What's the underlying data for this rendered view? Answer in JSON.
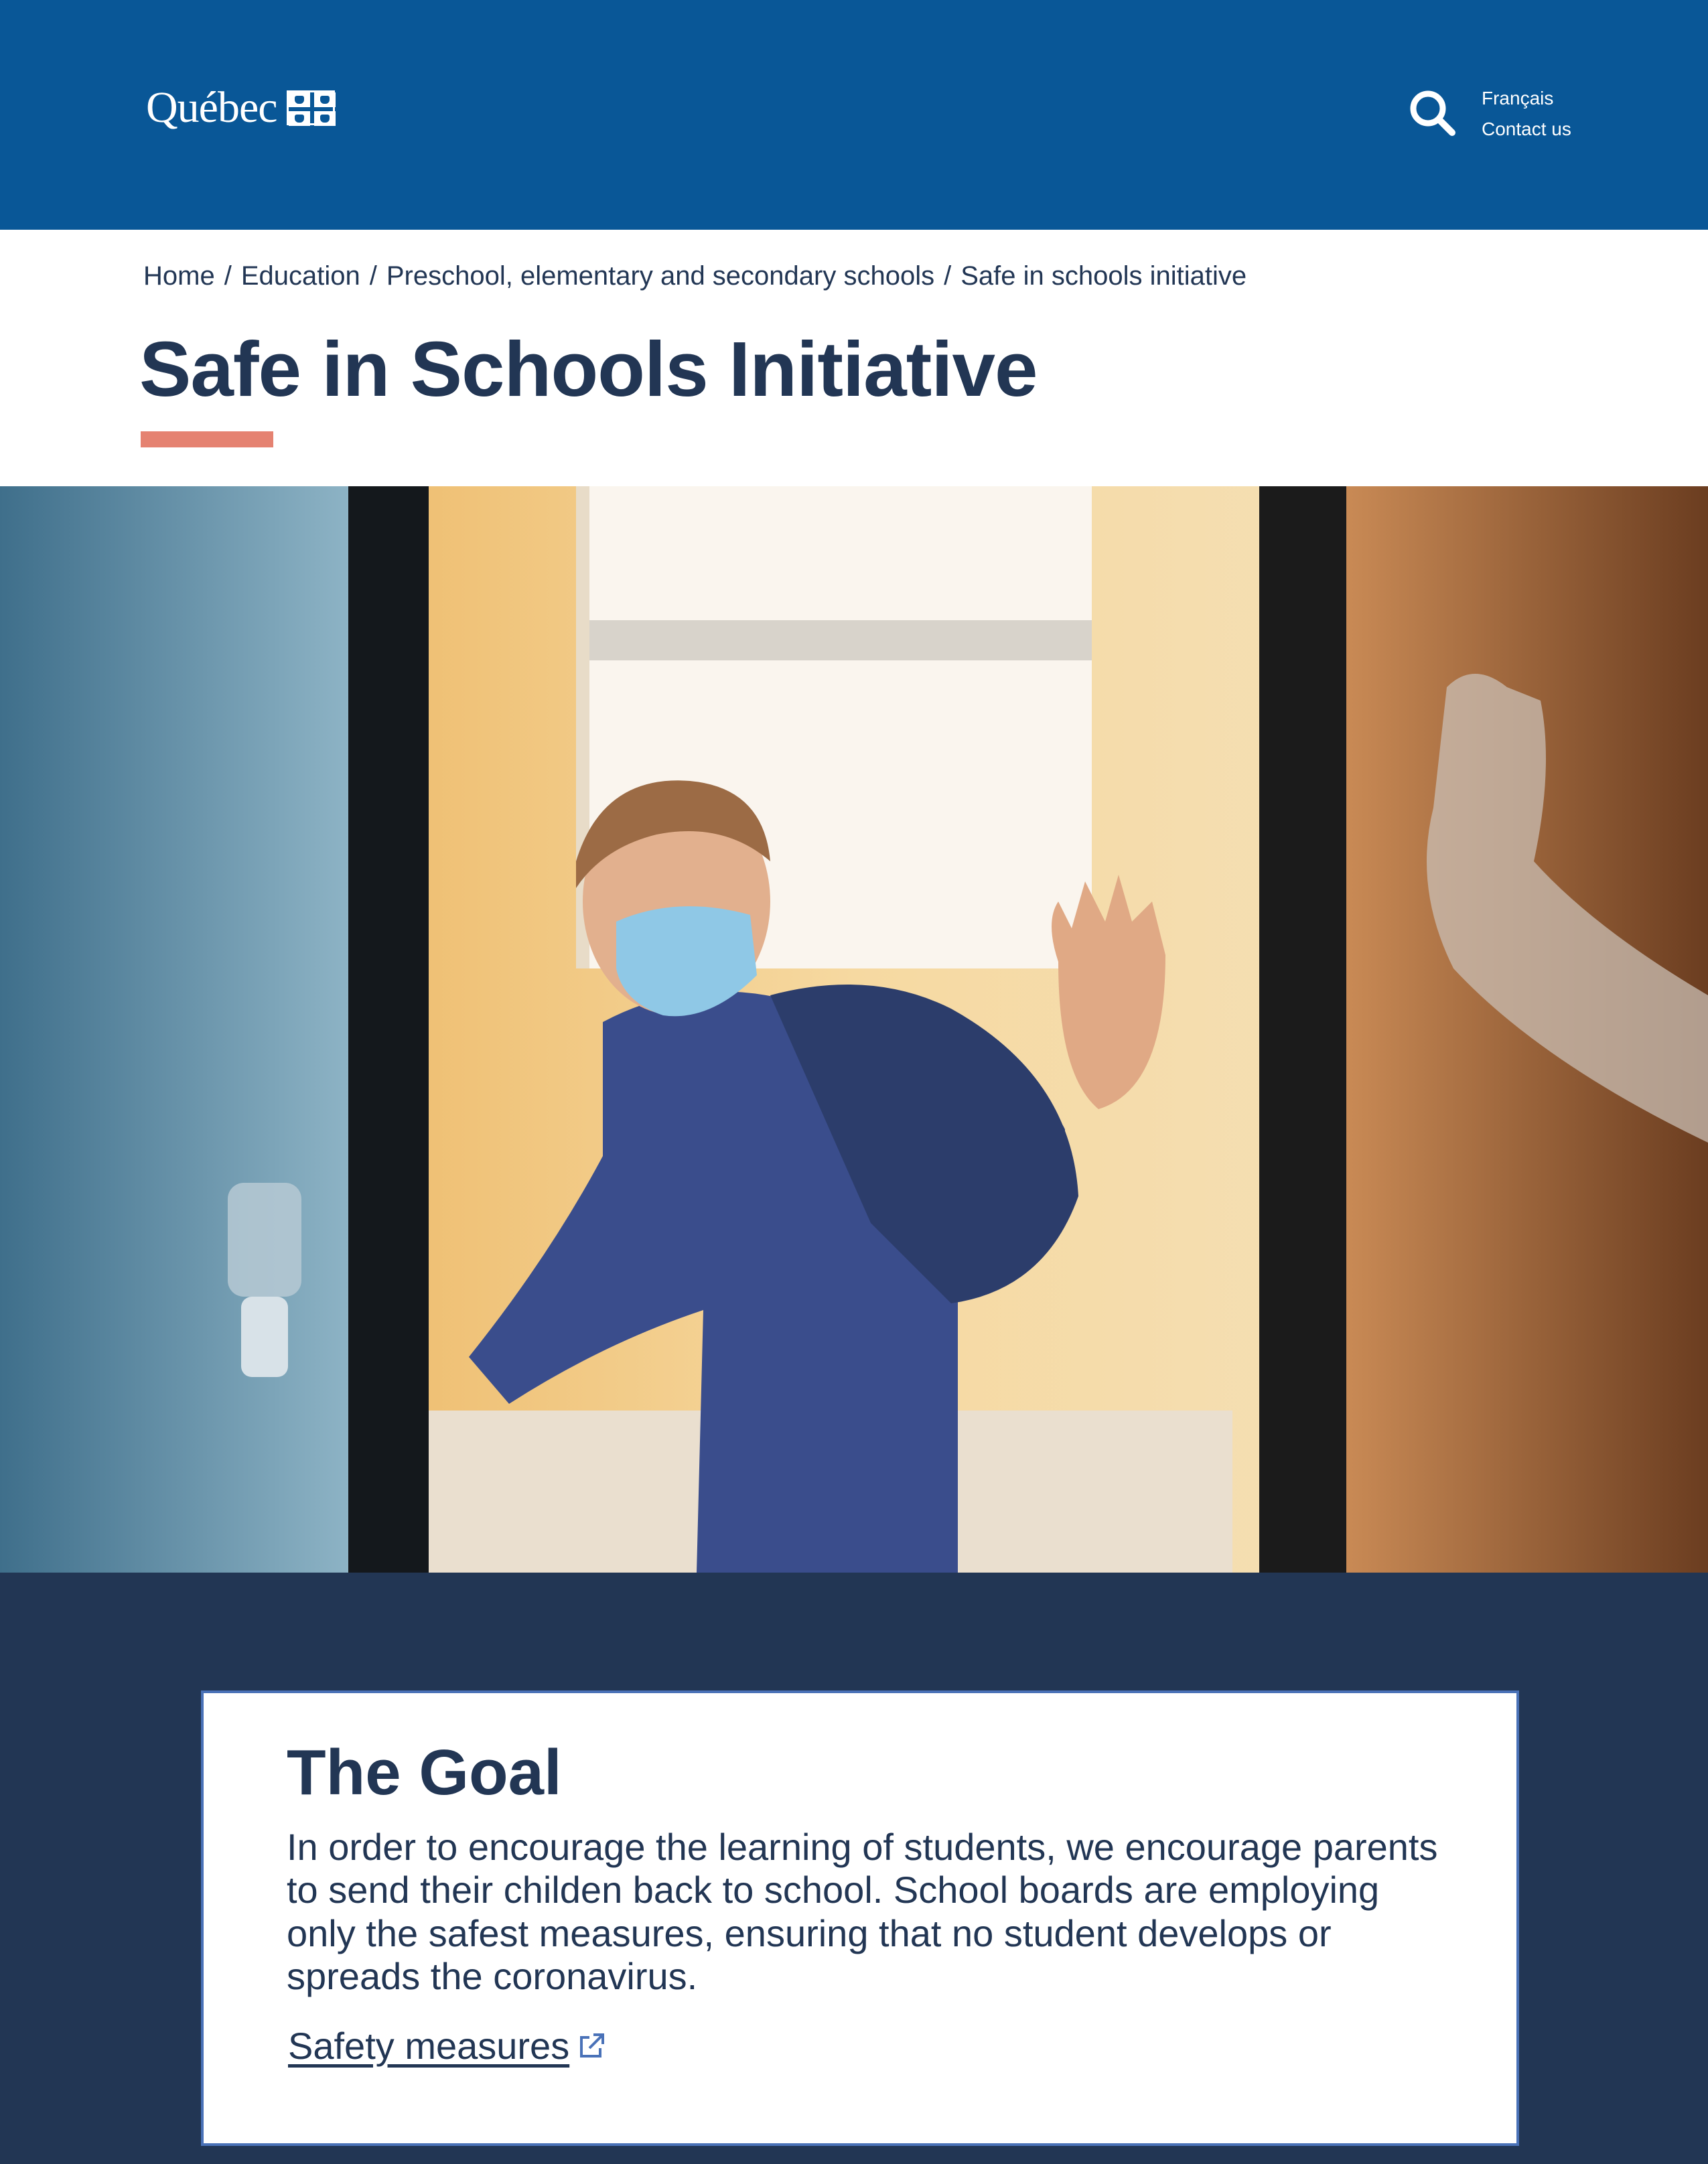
{
  "header": {
    "logo_text": "Québec",
    "search_icon": "search-icon",
    "lang_label": "Français",
    "contact_label": "Contact us",
    "brand_color": "#095797"
  },
  "breadcrumb": {
    "items": [
      "Home",
      "Education",
      "Preschool, elementary and secondary schools"
    ],
    "separator": "/",
    "current": "Safe in schools initiative"
  },
  "page": {
    "title": "Safe in Schools Initiative",
    "accent_color": "#e58271"
  },
  "hero": {
    "image": "Child wearing face mask and backpack waving goodbye in a doorway"
  },
  "goal": {
    "heading": "The Goal",
    "body": "In order to encourage the learning of students, we encourage parents to send their childen back to school. School boards are employing only the safest measures, ensuring that no student develops or spreads the coronavirus.",
    "link_label": "Safety measures",
    "link_icon": "external-link-icon",
    "section_color": "#223654"
  }
}
